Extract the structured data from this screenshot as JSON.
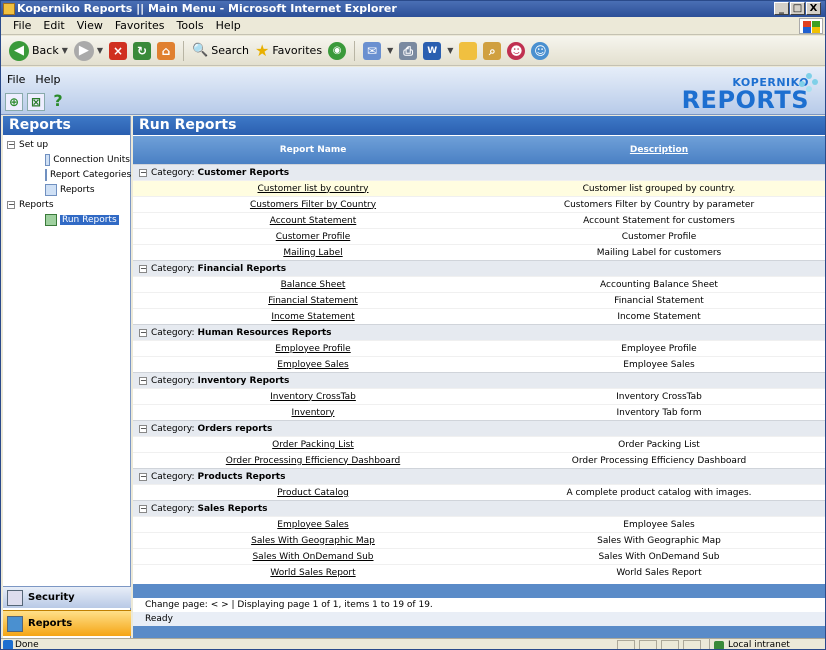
{
  "window": {
    "title": "Koperniko Reports || Main Menu - Microsoft Internet Explorer",
    "buttons": [
      "_",
      "□",
      "X"
    ]
  },
  "menubar": [
    "File",
    "Edit",
    "View",
    "Favorites",
    "Tools",
    "Help"
  ],
  "toolbar": {
    "back": "Back",
    "search": "Search",
    "favorites": "Favorites"
  },
  "app": {
    "menu": [
      "File",
      "Help"
    ],
    "logo_top": "KOPERNIKO",
    "logo_bottom": "REPORTS"
  },
  "sidebar": {
    "title": "Reports",
    "tree": [
      {
        "label": "Set up",
        "toggle": "−",
        "level": 0
      },
      {
        "label": "Connection Units",
        "level": 1
      },
      {
        "label": "Report Categories",
        "level": 1
      },
      {
        "label": "Reports",
        "level": 1
      },
      {
        "label": "Reports",
        "toggle": "−",
        "level": 0
      },
      {
        "label": "Run Reports",
        "level": 1,
        "selected": true
      }
    ],
    "security_label": "Security",
    "reports_label": "Reports"
  },
  "main": {
    "title": "Run Reports",
    "col_name": "Report Name",
    "col_desc": "Description",
    "category_prefix": "Category:",
    "categories": [
      {
        "name": "Customer Reports",
        "rows": [
          {
            "name": "Customer list by country",
            "desc": "Customer list grouped by country."
          },
          {
            "name": "Customers Filter by Country",
            "desc": "Customers Filter by Country by parameter"
          },
          {
            "name": "Account Statement",
            "desc": "Account Statement for customers"
          },
          {
            "name": "Customer Profile",
            "desc": "Customer Profile"
          },
          {
            "name": "Mailing Label",
            "desc": "Mailing Label for customers"
          }
        ]
      },
      {
        "name": "Financial Reports",
        "rows": [
          {
            "name": "Balance Sheet",
            "desc": "Accounting Balance Sheet"
          },
          {
            "name": "Financial Statement",
            "desc": "Financial Statement"
          },
          {
            "name": "Income Statement",
            "desc": "Income Statement"
          }
        ]
      },
      {
        "name": "Human Resources Reports",
        "rows": [
          {
            "name": "Employee Profile",
            "desc": "Employee Profile"
          },
          {
            "name": "Employee Sales",
            "desc": "Employee Sales"
          }
        ]
      },
      {
        "name": "Inventory Reports",
        "rows": [
          {
            "name": "Inventory CrossTab",
            "desc": "Inventory CrossTab"
          },
          {
            "name": "Inventory",
            "desc": "Inventory Tab form"
          }
        ]
      },
      {
        "name": "Orders reports",
        "rows": [
          {
            "name": "Order Packing List",
            "desc": "Order Packing List"
          },
          {
            "name": "Order Processing Efficiency Dashboard",
            "desc": "Order Processing Efficiency Dashboard"
          }
        ]
      },
      {
        "name": "Products Reports",
        "rows": [
          {
            "name": "Product Catalog",
            "desc": "A complete product catalog with images."
          }
        ]
      },
      {
        "name": "Sales Reports",
        "rows": [
          {
            "name": "Employee Sales",
            "desc": "Employee Sales"
          },
          {
            "name": "Sales With Geographic Map",
            "desc": "Sales With Geographic Map"
          },
          {
            "name": "Sales With OnDemand Sub",
            "desc": "Sales With OnDemand Sub"
          },
          {
            "name": "World Sales Report",
            "desc": "World Sales Report"
          }
        ]
      }
    ],
    "pager": "Change page: < > | Displaying page 1 of 1, items 1 to 19 of 19.",
    "ready": "Ready"
  },
  "statusbar": {
    "left": "Done",
    "zone": "Local intranet"
  }
}
